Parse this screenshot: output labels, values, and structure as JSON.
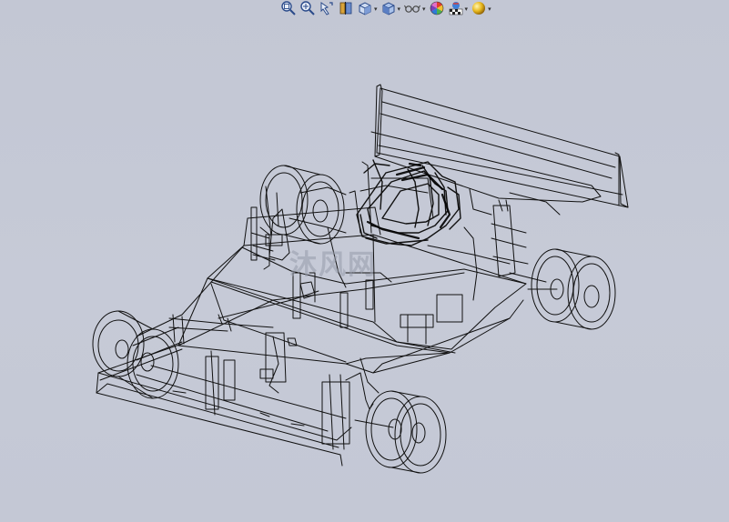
{
  "viewport": {
    "background_top": "#c3c7d4",
    "background_bottom": "#c4c8d5"
  },
  "toolbar": {
    "items": [
      {
        "icon": "zoom-to-fit-icon",
        "caret": false
      },
      {
        "icon": "zoom-to-area-icon",
        "caret": false
      },
      {
        "icon": "previous-view-icon",
        "caret": false
      },
      {
        "icon": "section-view-icon",
        "caret": false
      },
      {
        "icon": "view-orientation-icon",
        "caret": true
      },
      {
        "icon": "display-style-icon",
        "caret": true
      },
      {
        "icon": "hide-show-items-icon",
        "caret": true
      },
      {
        "icon": "edit-appearance-icon",
        "caret": false
      },
      {
        "icon": "apply-scene-icon",
        "caret": true
      },
      {
        "icon": "view-settings-icon",
        "caret": true
      }
    ],
    "caret_glyph": "▾"
  },
  "model": {
    "description_icon": "wireframe-race-car-chassis",
    "line_color": "#111111"
  },
  "watermark": {
    "text": "沐风网"
  }
}
